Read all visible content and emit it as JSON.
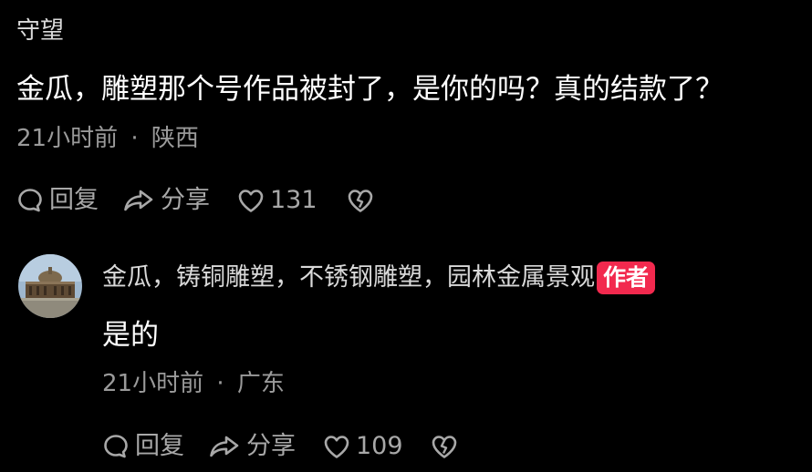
{
  "comment": {
    "username": "守望",
    "text": "金瓜，雕塑那个号作品被封了，是你的吗？真的结款了？",
    "time": "21小时前",
    "separator": "·",
    "location": "陕西",
    "reply_label": "回复",
    "share_label": "分享",
    "like_count": "131"
  },
  "reply": {
    "username": "金瓜，铸铜雕塑，不锈钢雕塑，园林金属景观",
    "author_badge": "作者",
    "text": "是的",
    "time": "21小时前",
    "separator": "·",
    "location": "广东",
    "reply_label": "回复",
    "share_label": "分享",
    "like_count": "109"
  },
  "icons": {
    "reply": "comment-bubble-icon",
    "share": "share-arrow-icon",
    "like": "heart-icon",
    "dislike": "broken-heart-icon"
  },
  "colors": {
    "background": "#000000",
    "primary_text": "#ffffff",
    "secondary_text": "#9a9a9a",
    "author_badge": "#f2294e"
  }
}
